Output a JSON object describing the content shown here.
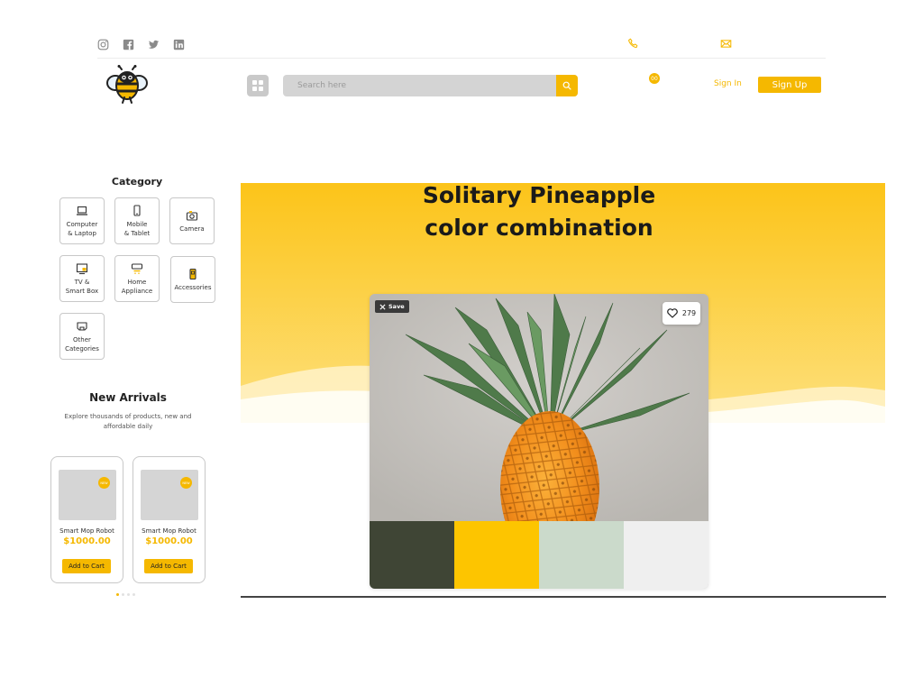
{
  "colors": {
    "accent": "#f5b800",
    "hero_top": "#fcc419",
    "hero_bottom": "#fde07d"
  },
  "header": {
    "social_icons": [
      "instagram-icon",
      "facebook-icon",
      "twitter-icon",
      "linkedin-icon"
    ],
    "contact_icons": [
      "phone-icon",
      "mail-icon"
    ],
    "search_placeholder": "Search here",
    "cart_count": "00",
    "signin_label": "Sign In",
    "signup_label": "Sign Up"
  },
  "sidebar": {
    "category_title": "Category",
    "categories": [
      {
        "label": "Computer\n& Laptop",
        "icon": "laptop-icon"
      },
      {
        "label": "Mobile\n& Tablet",
        "icon": "mobile-icon"
      },
      {
        "label": "Camera",
        "icon": "camera-icon"
      },
      {
        "label": "TV &\nSmart Box",
        "icon": "tv-icon"
      },
      {
        "label": "Home\nAppliance",
        "icon": "appliance-icon"
      },
      {
        "label": "Accessories",
        "icon": "accessories-icon"
      },
      {
        "label": "Other\nCategories",
        "icon": "other-icon"
      }
    ],
    "new_arrivals_title": "New Arrivals",
    "new_arrivals_subtitle": "Explore thousands of products, new and affordable daily",
    "products": [
      {
        "badge": "NEW",
        "name": "Smart Mop Robot",
        "price": "$1000.00",
        "cta": "Add to Cart"
      },
      {
        "badge": "NEW",
        "name": "Smart Mop Robot",
        "price": "$1000.00",
        "cta": "Add to Cart"
      }
    ],
    "carousel_active_index": 0,
    "carousel_count": 4
  },
  "hero": {
    "title": "Solitary Pineapple color combination",
    "save_label": "Save",
    "like_count": "279",
    "palette": [
      "#3f4535",
      "#fdc500",
      "#cbdacb",
      "#efefef"
    ]
  }
}
